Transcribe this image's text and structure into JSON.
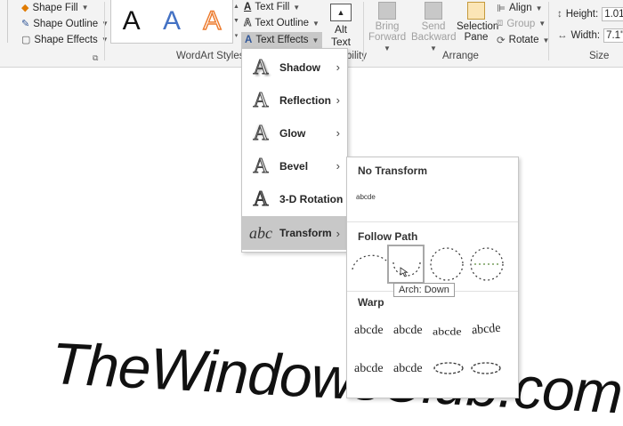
{
  "ribbon": {
    "shape_fill": "Shape Fill",
    "shape_outline": "Shape Outline",
    "shape_effects": "Shape Effects",
    "wordart_sample": "A",
    "text_fill": "Text Fill",
    "text_outline": "Text Outline",
    "text_effects": "Text Effects",
    "wordart_group": "WordArt Styles",
    "alt_text_1": "Alt",
    "alt_text_2": "Text",
    "accessibility_partial": "bility",
    "bring_forward_1": "Bring",
    "bring_forward_2": "Forward",
    "send_backward_1": "Send",
    "send_backward_2": "Backward",
    "selection_pane_1": "Selection",
    "selection_pane_2": "Pane",
    "align": "Align",
    "group": "Group",
    "rotate": "Rotate",
    "arrange_group": "Arrange",
    "height_label": "Height:",
    "height_value": "1.01\"",
    "width_label": "Width:",
    "width_value": "7.1\"",
    "size_group": "Size"
  },
  "text_effects_menu": {
    "items": [
      {
        "label": "Shadow",
        "icon": "A"
      },
      {
        "label": "Reflection",
        "icon": "A"
      },
      {
        "label": "Glow",
        "icon": "A"
      },
      {
        "label": "Bevel",
        "icon": "A"
      },
      {
        "label": "3-D Rotation",
        "icon": "A"
      },
      {
        "label": "Transform",
        "icon": "abc"
      }
    ]
  },
  "transform_submenu": {
    "no_transform_heading": "No Transform",
    "no_transform_sample": "abcde",
    "follow_path_heading": "Follow Path",
    "warp_heading": "Warp",
    "warp_samples": [
      "abcde",
      "abcde",
      "abcde",
      "abcde",
      "abcde",
      "abcde"
    ],
    "tooltip": "Arch: Down"
  },
  "document": {
    "text": "TheWindowsClub.com"
  },
  "colors": {
    "ribbon_bg": "#f3f3f3",
    "accent_blue": "#4472c4",
    "accent_orange": "#ed7d31",
    "menu_active": "#c8c8c8"
  }
}
